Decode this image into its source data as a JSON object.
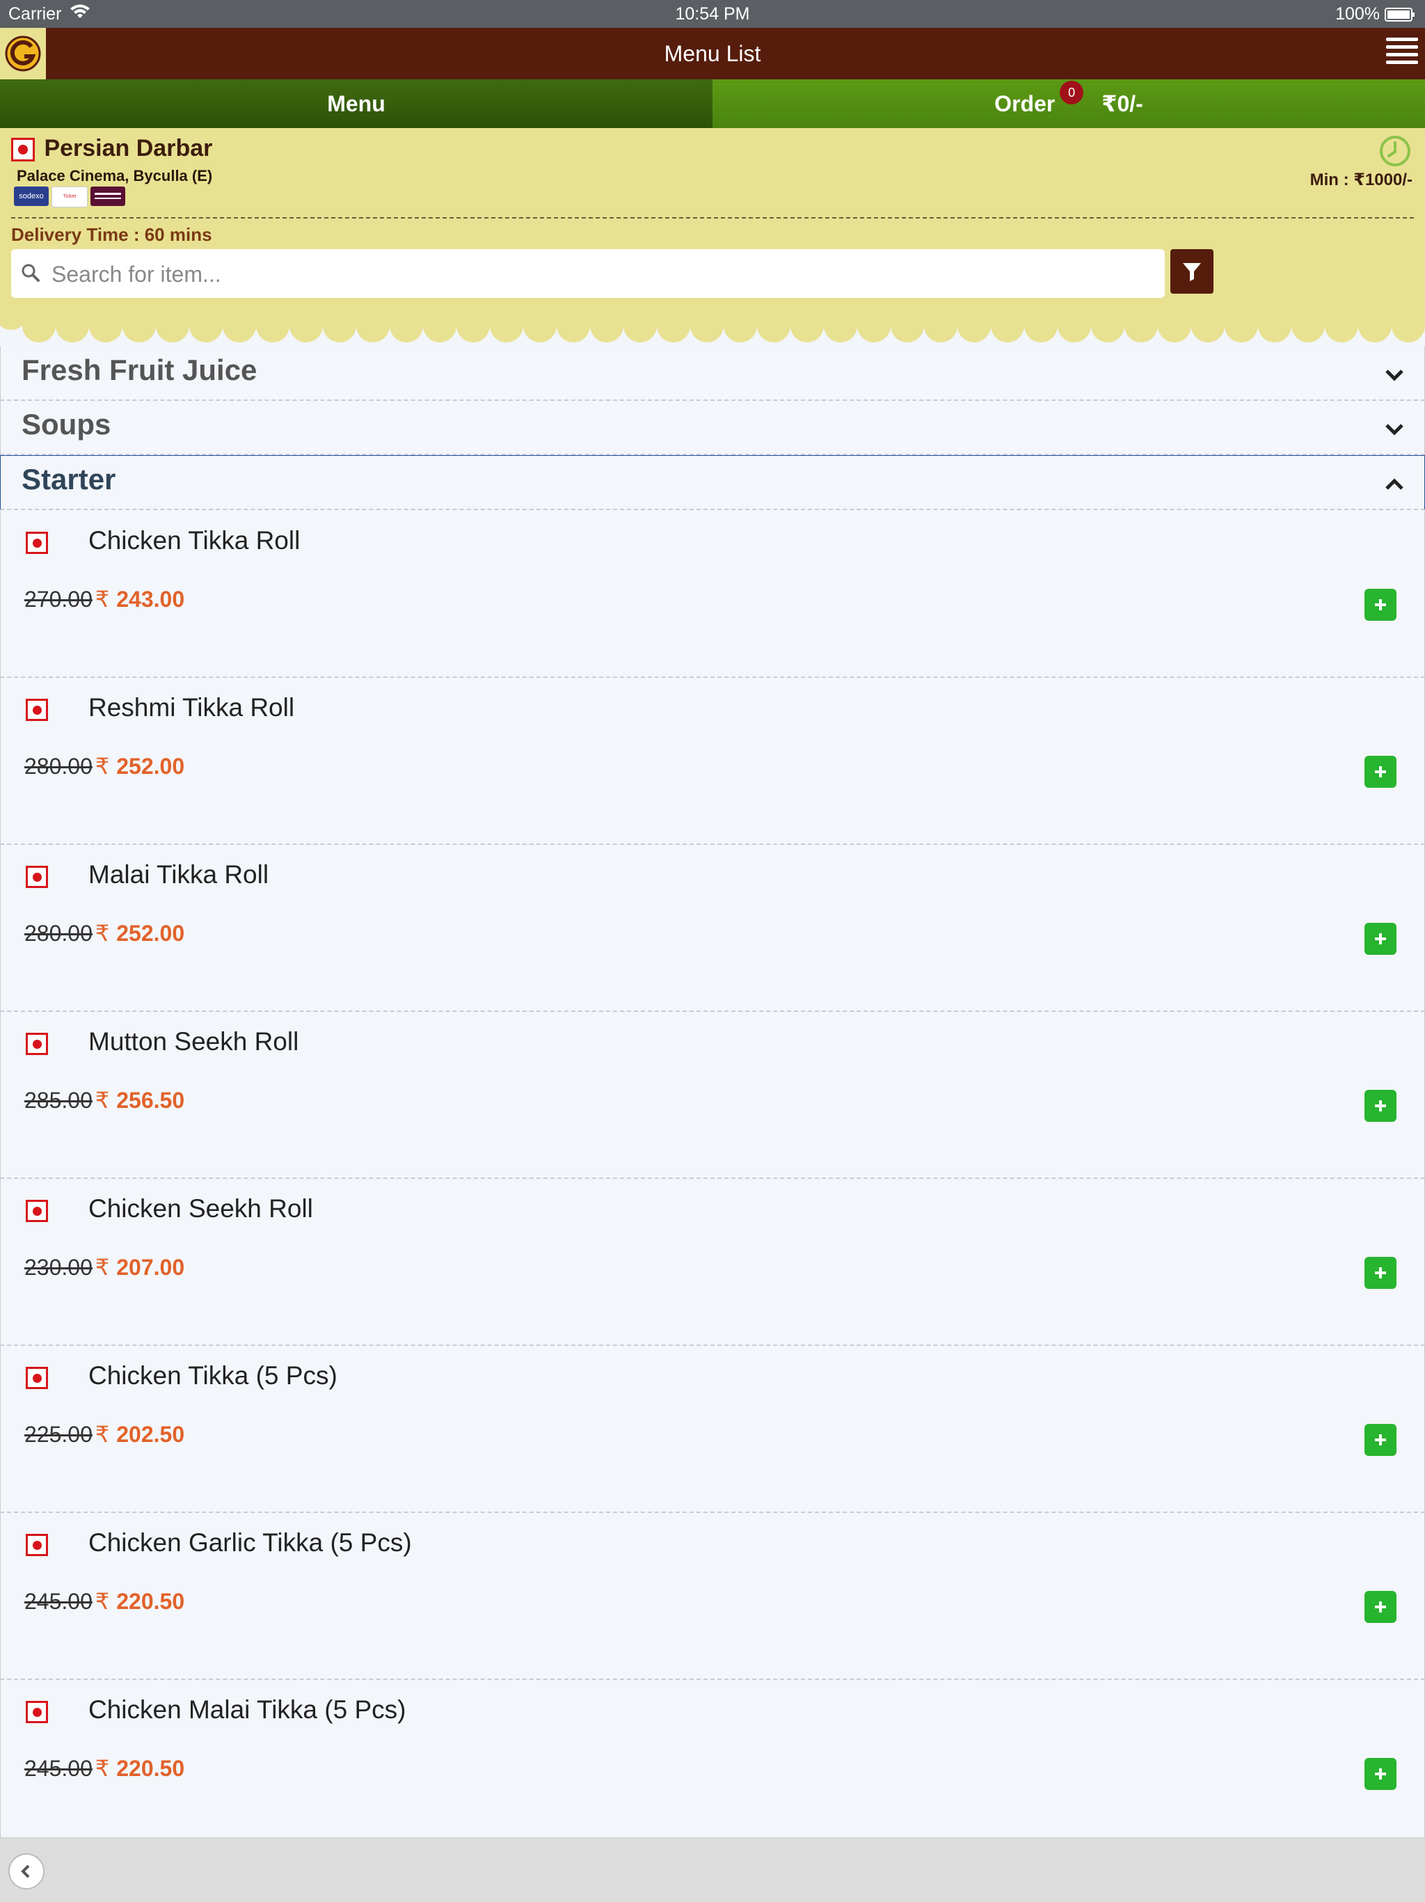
{
  "status_bar": {
    "carrier": "Carrier",
    "time": "10:54 PM",
    "battery": "100%"
  },
  "header": {
    "title": "Menu List"
  },
  "tabs": {
    "menu_label": "Menu",
    "order_label": "Order",
    "order_count": "0",
    "order_amount": "₹0/-"
  },
  "restaurant": {
    "name": "Persian Darbar",
    "address": "Palace Cinema, Byculla (E)",
    "cards": [
      "sodexo",
      "Ticket Restaurant",
      ""
    ],
    "min_order": "Min : ₹1000/-",
    "delivery_time": "Delivery Time : 60 mins"
  },
  "search": {
    "placeholder": "Search for item..."
  },
  "categories": [
    {
      "label": "Fresh Fruit Juice",
      "expanded": false
    },
    {
      "label": "Soups",
      "expanded": false
    },
    {
      "label": "Starter",
      "expanded": true
    }
  ],
  "items": [
    {
      "name": "Chicken Tikka Roll",
      "old_price": "270.00",
      "currency": "₹",
      "price": "243.00"
    },
    {
      "name": "Reshmi Tikka Roll",
      "old_price": "280.00",
      "currency": "₹",
      "price": "252.00"
    },
    {
      "name": "Malai Tikka Roll",
      "old_price": "280.00",
      "currency": "₹",
      "price": "252.00"
    },
    {
      "name": "Mutton Seekh Roll",
      "old_price": "285.00",
      "currency": "₹",
      "price": "256.50"
    },
    {
      "name": "Chicken Seekh Roll",
      "old_price": "230.00",
      "currency": "₹",
      "price": "207.00"
    },
    {
      "name": "Chicken Tikka (5 Pcs)",
      "old_price": "225.00",
      "currency": "₹",
      "price": "202.50"
    },
    {
      "name": "Chicken Garlic Tikka (5 Pcs)",
      "old_price": "245.00",
      "currency": "₹",
      "price": "220.50"
    },
    {
      "name": "Chicken Malai Tikka (5 Pcs)",
      "old_price": "245.00",
      "currency": "₹",
      "price": "220.50"
    }
  ],
  "colors": {
    "header_brown": "#561d0c",
    "tab_dark_green": "#2d5208",
    "tab_light_green": "#5d9a14",
    "panel_yellow": "#e8e192",
    "price_orange": "#e2622a",
    "add_green": "#27b42f",
    "nonveg_red": "#d7141a"
  }
}
